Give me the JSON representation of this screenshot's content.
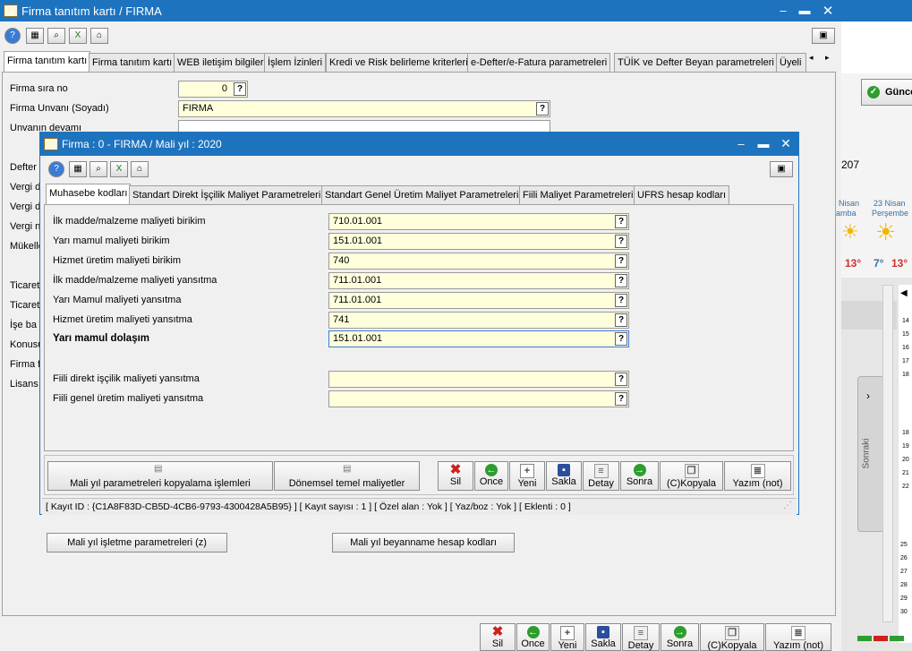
{
  "outer": {
    "title": "Firma tanıtım kartı / FIRMA",
    "tabs": [
      "Firma tanıtım kartı",
      "Firma tanıtım kartı",
      "WEB iletişim bilgileri",
      "İşlem İzinleri",
      "Kredi ve Risk belirleme kriterleri",
      "e-Defter/e-Fatura parametreleri",
      "TÜİK ve Defter Beyan parametreleri",
      "Üyeli"
    ],
    "fields": {
      "sira_no_label": "Firma sıra no",
      "sira_no_value": "0",
      "unvan_label": "Firma Unvanı (Soyadı)",
      "unvan_value": "FIRMA",
      "unvan_devami_label": "Unvanın devamı"
    },
    "partial_labels": [
      "Defter",
      "Vergi d",
      "Vergi d",
      "Vergi n",
      "Mükelle",
      "Ticaret",
      "Ticaret",
      "İşe ba",
      "Konusu",
      "Firma f",
      "Lisans"
    ],
    "bottom_buttons": {
      "isletme": "Mali yıl işletme parametreleri (z)",
      "beyanname": "Mali yıl beyanname hesap kodları"
    },
    "nav": [
      "Sil",
      "Once",
      "Yeni",
      "Sakla",
      "Detay",
      "Sonra",
      "(C)Kopyala",
      "Yazım (not)"
    ]
  },
  "dialog": {
    "title": "Firma : 0 -  FIRMA / Mali yıl : 2020",
    "tabs": [
      "Muhasebe kodları",
      "Standart Direkt İşçilik Maliyet Parametreleri",
      "Standart Genel Üretim Maliyet Parametreleri",
      "Fiili Maliyet Parametreleri",
      "UFRS hesap kodları"
    ],
    "rows": [
      {
        "label": "İlk madde/malzeme maliyeti birikim",
        "value": "710.01.001"
      },
      {
        "label": "Yarı mamul maliyeti birikim",
        "value": "151.01.001"
      },
      {
        "label": "Hizmet üretim maliyeti birikim",
        "value": "740"
      },
      {
        "label": "İlk madde/malzeme maliyeti yansıtma",
        "value": "711.01.001"
      },
      {
        "label": "Yarı Mamul maliyeti yansıtma",
        "value": "711.01.001"
      },
      {
        "label": "Hizmet üretim maliyeti yansıtma",
        "value": "741"
      },
      {
        "label": "Yarı mamul dolaşım",
        "value": "151.01.001"
      },
      {
        "label": "Fiili direkt işçilik maliyeti yansıtma",
        "value": ""
      },
      {
        "label": "Fiili genel üretim maliyeti yansıtma",
        "value": ""
      }
    ],
    "buttons": {
      "kopyalama": "Mali yıl parametreleri kopyalama işlemleri",
      "donemsel": "Dönemsel temel maliyetler"
    },
    "nav": [
      "Sil",
      "Once",
      "Yeni",
      "Sakla",
      "Detay",
      "Sonra",
      "(C)Kopyala",
      "Yazım (not)"
    ],
    "status": "[ Kayıt ID : {C1A8F83D-CB5D-4CB6-9793-4300428A5B95} ] [ Kayıt sayısı : 1 ] [ Özel alan : Yok ] [ Yaz/boz : Yok ] [ Eklenti : 0 ]"
  },
  "right_app": {
    "button": "Günce",
    "number": "207",
    "weather": [
      {
        "day1": "Nisan",
        "day2": "amba",
        "temp_low": "",
        "temp_high": "13°"
      },
      {
        "day1": "23 Nisan",
        "day2": "Perşembe",
        "temp_low": "7°",
        "temp_high": "13°"
      }
    ],
    "side_label": "Sonraki",
    "cal_numbers_top": [
      "14",
      "15",
      "16",
      "17",
      "18"
    ],
    "cal_numbers_bottom": [
      "18",
      "19",
      "20",
      "21",
      "22"
    ],
    "cal_numbers_low": [
      "25",
      "26",
      "27",
      "28",
      "29",
      "30"
    ]
  },
  "colors": {
    "title_blue": "#1e73be",
    "field_yellow": "#ffffdc"
  }
}
